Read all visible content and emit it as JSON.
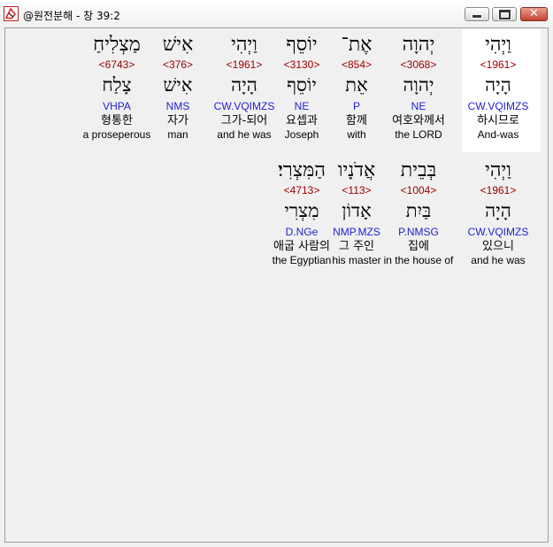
{
  "window": {
    "title": "@원전분해 - 창 39:2"
  },
  "rows": [
    {
      "words": [
        {
          "heb": "וַיְהִי",
          "strong": "<1961>",
          "root": "הָיָה",
          "parse": "CW.VQIMZS",
          "kor": "하시므로",
          "eng": "And-was",
          "selected": true
        },
        {
          "heb": "יְהוָה",
          "strong": "<3068>",
          "root": "יְהוָה",
          "parse": "NE",
          "kor": "여호와께서",
          "eng": "the LORD"
        },
        {
          "heb": "אֶת־",
          "strong": "<854>",
          "root": "אֵת",
          "parse": "P",
          "kor": "함께",
          "eng": "with"
        },
        {
          "heb": "יוֹסֵף",
          "strong": "<3130>",
          "root": "יוֹסֵף",
          "parse": "NE",
          "kor": "요셉과",
          "eng": "Joseph"
        },
        {
          "heb": "וַיְהִי",
          "strong": "<1961>",
          "root": "הָיָה",
          "parse": "CW.VQIMZS",
          "kor": "그가-되어",
          "eng": "and he was"
        },
        {
          "heb": "אִישׁ",
          "strong": "<376>",
          "root": "אִישׁ",
          "parse": "NMS",
          "kor": "자가",
          "eng": "man"
        },
        {
          "heb": "מַצְלִיחַ",
          "strong": "<6743>",
          "root": "צָלַח",
          "parse": "VHPA",
          "kor": "형통한",
          "eng": "a proseperous"
        }
      ]
    },
    {
      "words": [
        {
          "heb": "וַיְהִי",
          "strong": "<1961>",
          "root": "הָיָה",
          "parse": "CW.VQIMZS",
          "kor": "있으니",
          "eng": "and he was"
        },
        {
          "heb": "בְּבֵית",
          "strong": "<1004>",
          "root": "בַּיִת",
          "parse": "P.NMSG",
          "kor": "집에",
          "eng": "in the house of"
        },
        {
          "heb": "אֲדֹנָיו",
          "strong": "<113>",
          "root": "אָדוֹן",
          "parse": "NMP.MZS",
          "kor": "그 주인",
          "eng": "his master"
        },
        {
          "heb": "הַמִּצְרִי׃",
          "strong": "<4713>",
          "root": "מִצְרִי",
          "parse": "D.NGe",
          "kor": "애굽 사람의",
          "eng": "the Egyptian"
        }
      ]
    }
  ]
}
